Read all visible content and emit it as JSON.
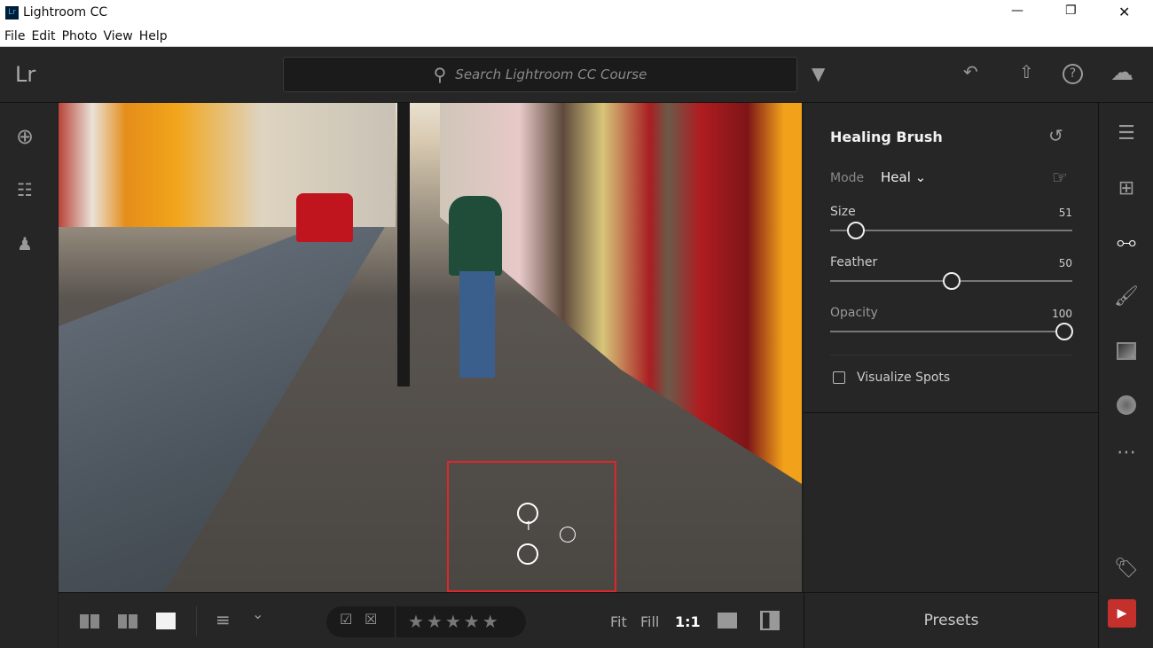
{
  "window": {
    "title": "Lightroom CC",
    "minimize": "—",
    "maximize": "❐",
    "close": "✕"
  },
  "menu": [
    "File",
    "Edit",
    "Photo",
    "View",
    "Help"
  ],
  "topbar": {
    "logo": "Lr",
    "search_placeholder": "Search Lightroom CC Course"
  },
  "panel": {
    "title": "Healing Brush",
    "mode_label": "Mode",
    "mode_value": "Heal",
    "sliders": [
      {
        "label": "Size",
        "value": 51,
        "fraction": 0.08
      },
      {
        "label": "Feather",
        "value": 50,
        "fraction": 0.5
      },
      {
        "label": "Opacity",
        "value": 100,
        "fraction": 1.0
      }
    ],
    "visualize_label": "Visualize Spots",
    "visualize_checked": false
  },
  "bottombar": {
    "stars": "★★★★★",
    "fit": "Fit",
    "fill": "Fill",
    "one_to_one": "1:1"
  },
  "presets": "Presets",
  "colors": {
    "selection_box": "#e0262b",
    "accent": "#ffffff"
  }
}
